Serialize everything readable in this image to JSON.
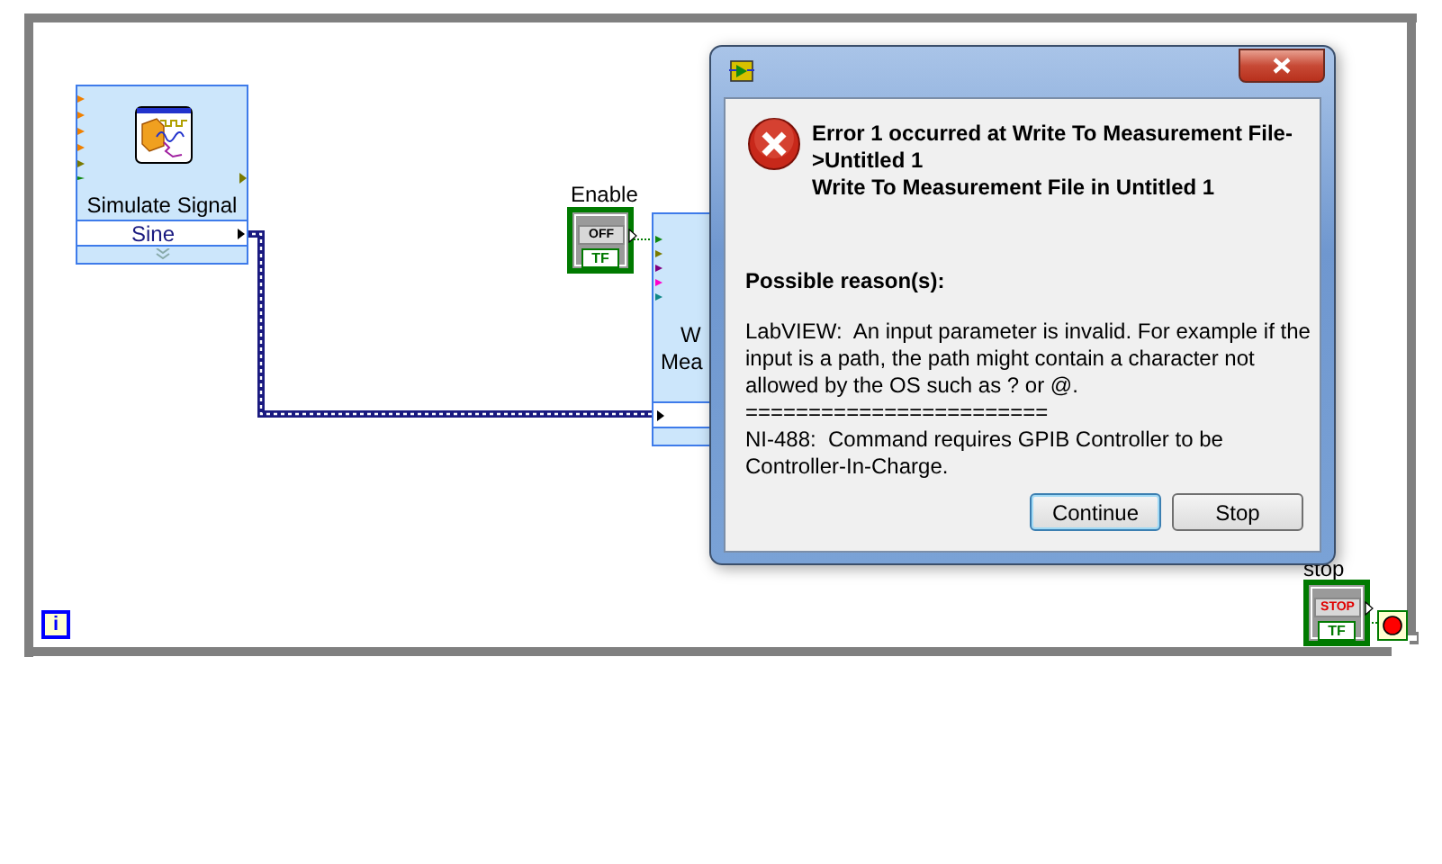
{
  "block_diagram": {
    "simulate_signal": {
      "title": "Simulate Signal",
      "output": "Sine"
    },
    "enable": {
      "label": "Enable",
      "state": "OFF",
      "type_label": "TF"
    },
    "write_node": {
      "text_lines": [
        "W",
        "Mea"
      ]
    },
    "stop_control": {
      "label": "stop",
      "state": "STOP",
      "type_label": "TF"
    },
    "iteration": "i"
  },
  "dialog": {
    "title_lines": [
      "Error 1 occurred at Write To Measurement File-",
      ">Untitled 1",
      "Write To Measurement File in Untitled 1"
    ],
    "heading": "Possible reason(s):",
    "paragraphs": [
      "LabVIEW:  An input parameter is invalid. For example if the input is a path, the path might contain a character not allowed by the OS such as ? or @.",
      "========================",
      "NI-488:  Command requires GPIB Controller to be Controller-In-Charge."
    ],
    "buttons": [
      {
        "label": "Continue",
        "default": true
      },
      {
        "label": "Stop",
        "default": false
      }
    ]
  }
}
